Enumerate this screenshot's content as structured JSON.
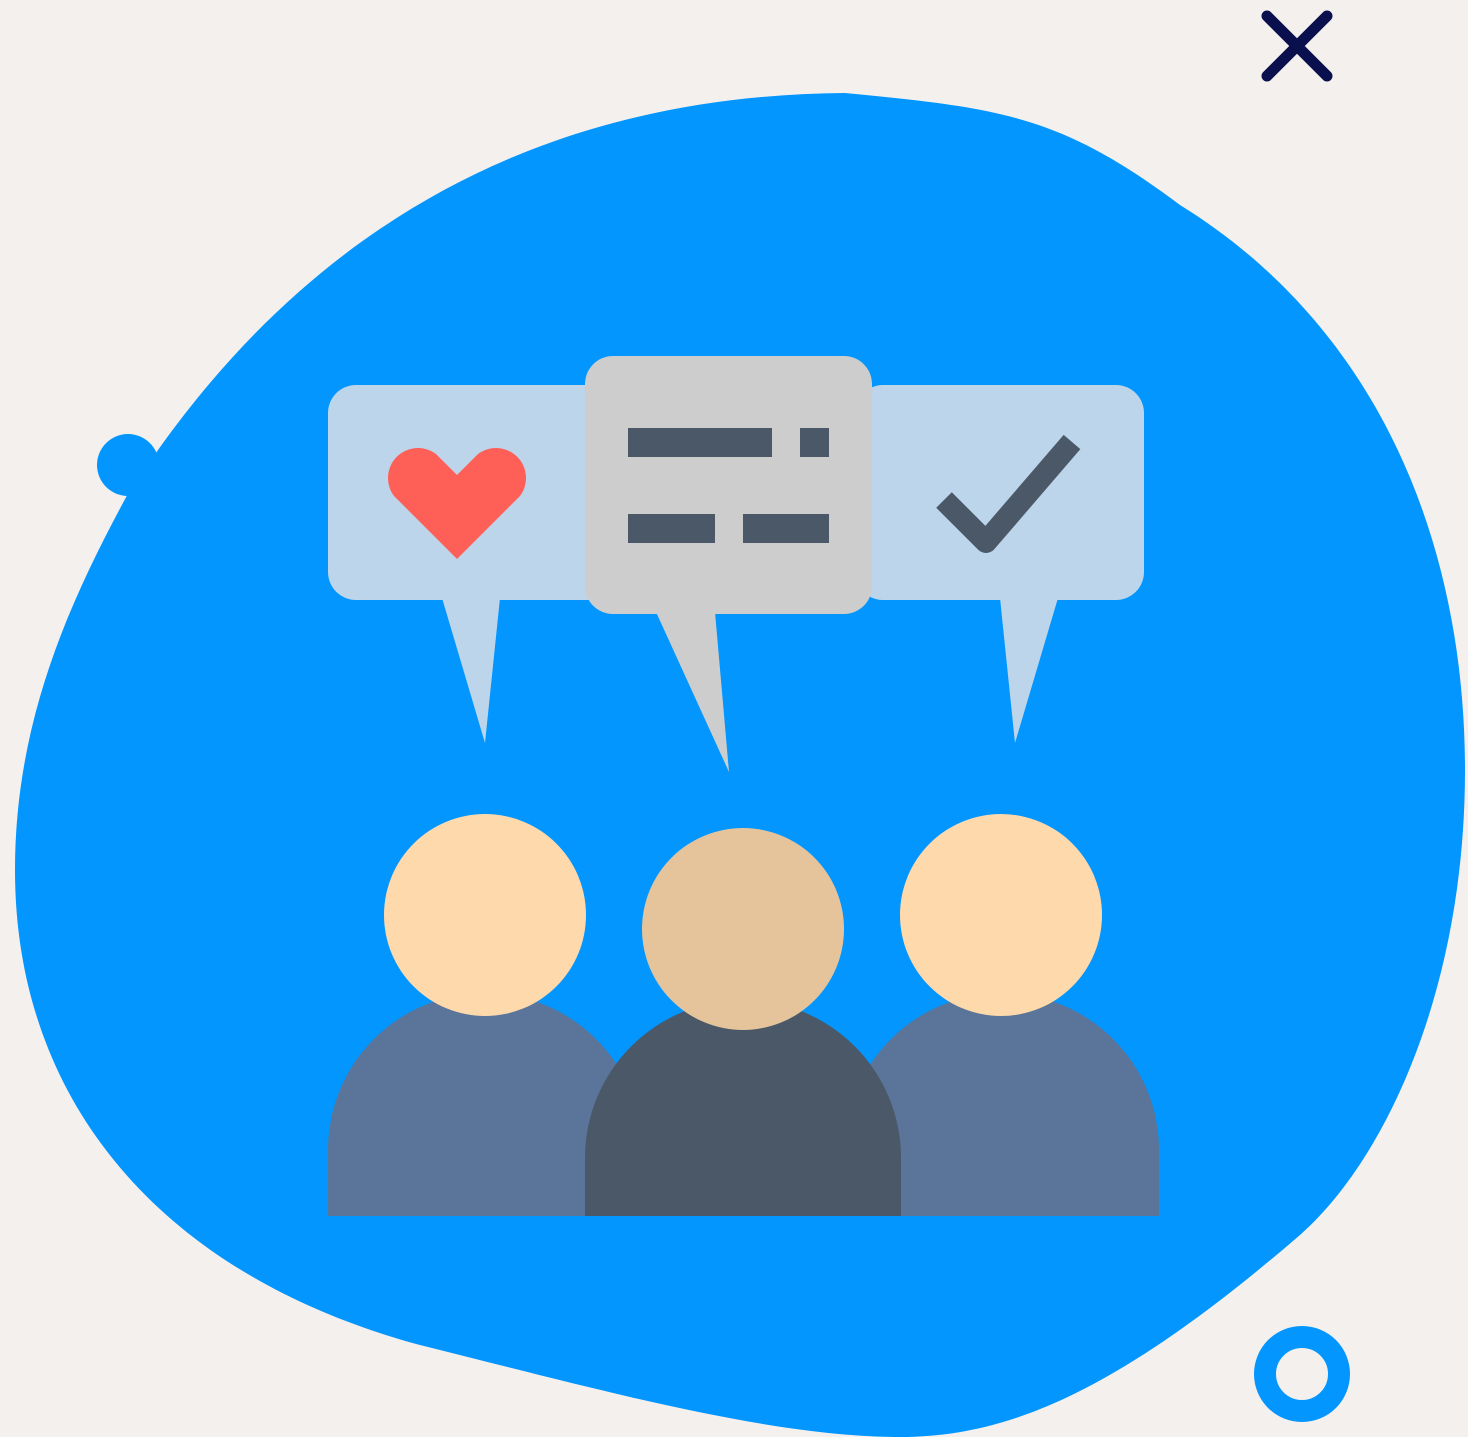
{
  "scene": {
    "background_color": "#F3F0ED",
    "blob_color": "#0296FE",
    "close_icon_color": "#0A0F4E",
    "ring_color": "#0296FE",
    "bubbles": {
      "side_color": "#BDD5EA",
      "center_color": "#CDCDCD",
      "line_color": "#4A5868"
    },
    "icons": {
      "left_bubble": "heart-icon",
      "center_bubble": "text-lines-icon",
      "right_bubble": "checkmark-icon",
      "corner": "close-icon",
      "ring": "ring-icon"
    },
    "people": [
      {
        "name": "left-person",
        "head_color": "#FED9AC",
        "body_color": "#5A7599"
      },
      {
        "name": "center-person",
        "head_color": "#E5C49C",
        "body_color": "#4A5868"
      },
      {
        "name": "right-person",
        "head_color": "#FED9AC",
        "body_color": "#5A7599"
      }
    ],
    "heart_color": "#FE5F57"
  }
}
